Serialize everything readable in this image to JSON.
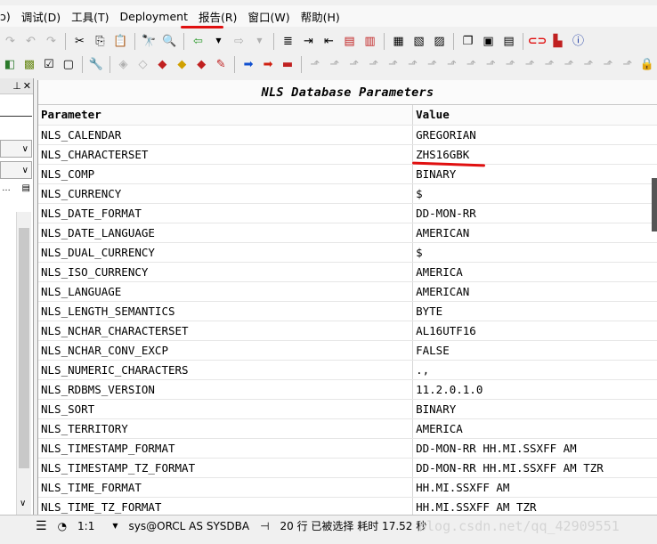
{
  "menu": {
    "items": [
      "调试(D)",
      "工具(T)",
      "Deployment",
      "报告(R)",
      "窗口(W)",
      "帮助(H)"
    ],
    "partial_left": "ɔ)"
  },
  "panel": {
    "pin_glyph": "  ×"
  },
  "report": {
    "title": "NLS Database Parameters",
    "columns": [
      "Parameter",
      "Value"
    ],
    "rows": [
      [
        "NLS_CALENDAR",
        "GREGORIAN"
      ],
      [
        "NLS_CHARACTERSET",
        "ZHS16GBK"
      ],
      [
        "NLS_COMP",
        "BINARY"
      ],
      [
        "NLS_CURRENCY",
        "$"
      ],
      [
        "NLS_DATE_FORMAT",
        "DD-MON-RR"
      ],
      [
        "NLS_DATE_LANGUAGE",
        "AMERICAN"
      ],
      [
        "NLS_DUAL_CURRENCY",
        "$"
      ],
      [
        "NLS_ISO_CURRENCY",
        "AMERICA"
      ],
      [
        "NLS_LANGUAGE",
        "AMERICAN"
      ],
      [
        "NLS_LENGTH_SEMANTICS",
        "BYTE"
      ],
      [
        "NLS_NCHAR_CHARACTERSET",
        "AL16UTF16"
      ],
      [
        "NLS_NCHAR_CONV_EXCP",
        "FALSE"
      ],
      [
        "NLS_NUMERIC_CHARACTERS",
        ".,"
      ],
      [
        "NLS_RDBMS_VERSION",
        "11.2.0.1.0"
      ],
      [
        "NLS_SORT",
        "BINARY"
      ],
      [
        "NLS_TERRITORY",
        "AMERICA"
      ],
      [
        "NLS_TIMESTAMP_FORMAT",
        "DD-MON-RR HH.MI.SSXFF AM"
      ],
      [
        "NLS_TIMESTAMP_TZ_FORMAT",
        "DD-MON-RR HH.MI.SSXFF AM TZR"
      ],
      [
        "NLS_TIME_FORMAT",
        "HH.MI.SSXFF AM"
      ],
      [
        "NLS_TIME_TZ_FORMAT",
        "HH.MI.SSXFF AM TZR"
      ]
    ]
  },
  "status": {
    "position": "1:1",
    "connection": "sys@ORCL AS SYSDBA",
    "message": "20 行 已被选择 耗时 17.52 秒",
    "watermark": "blog.csdn.net/qq_42909551"
  },
  "colors": {
    "annotation": "#e01010"
  }
}
